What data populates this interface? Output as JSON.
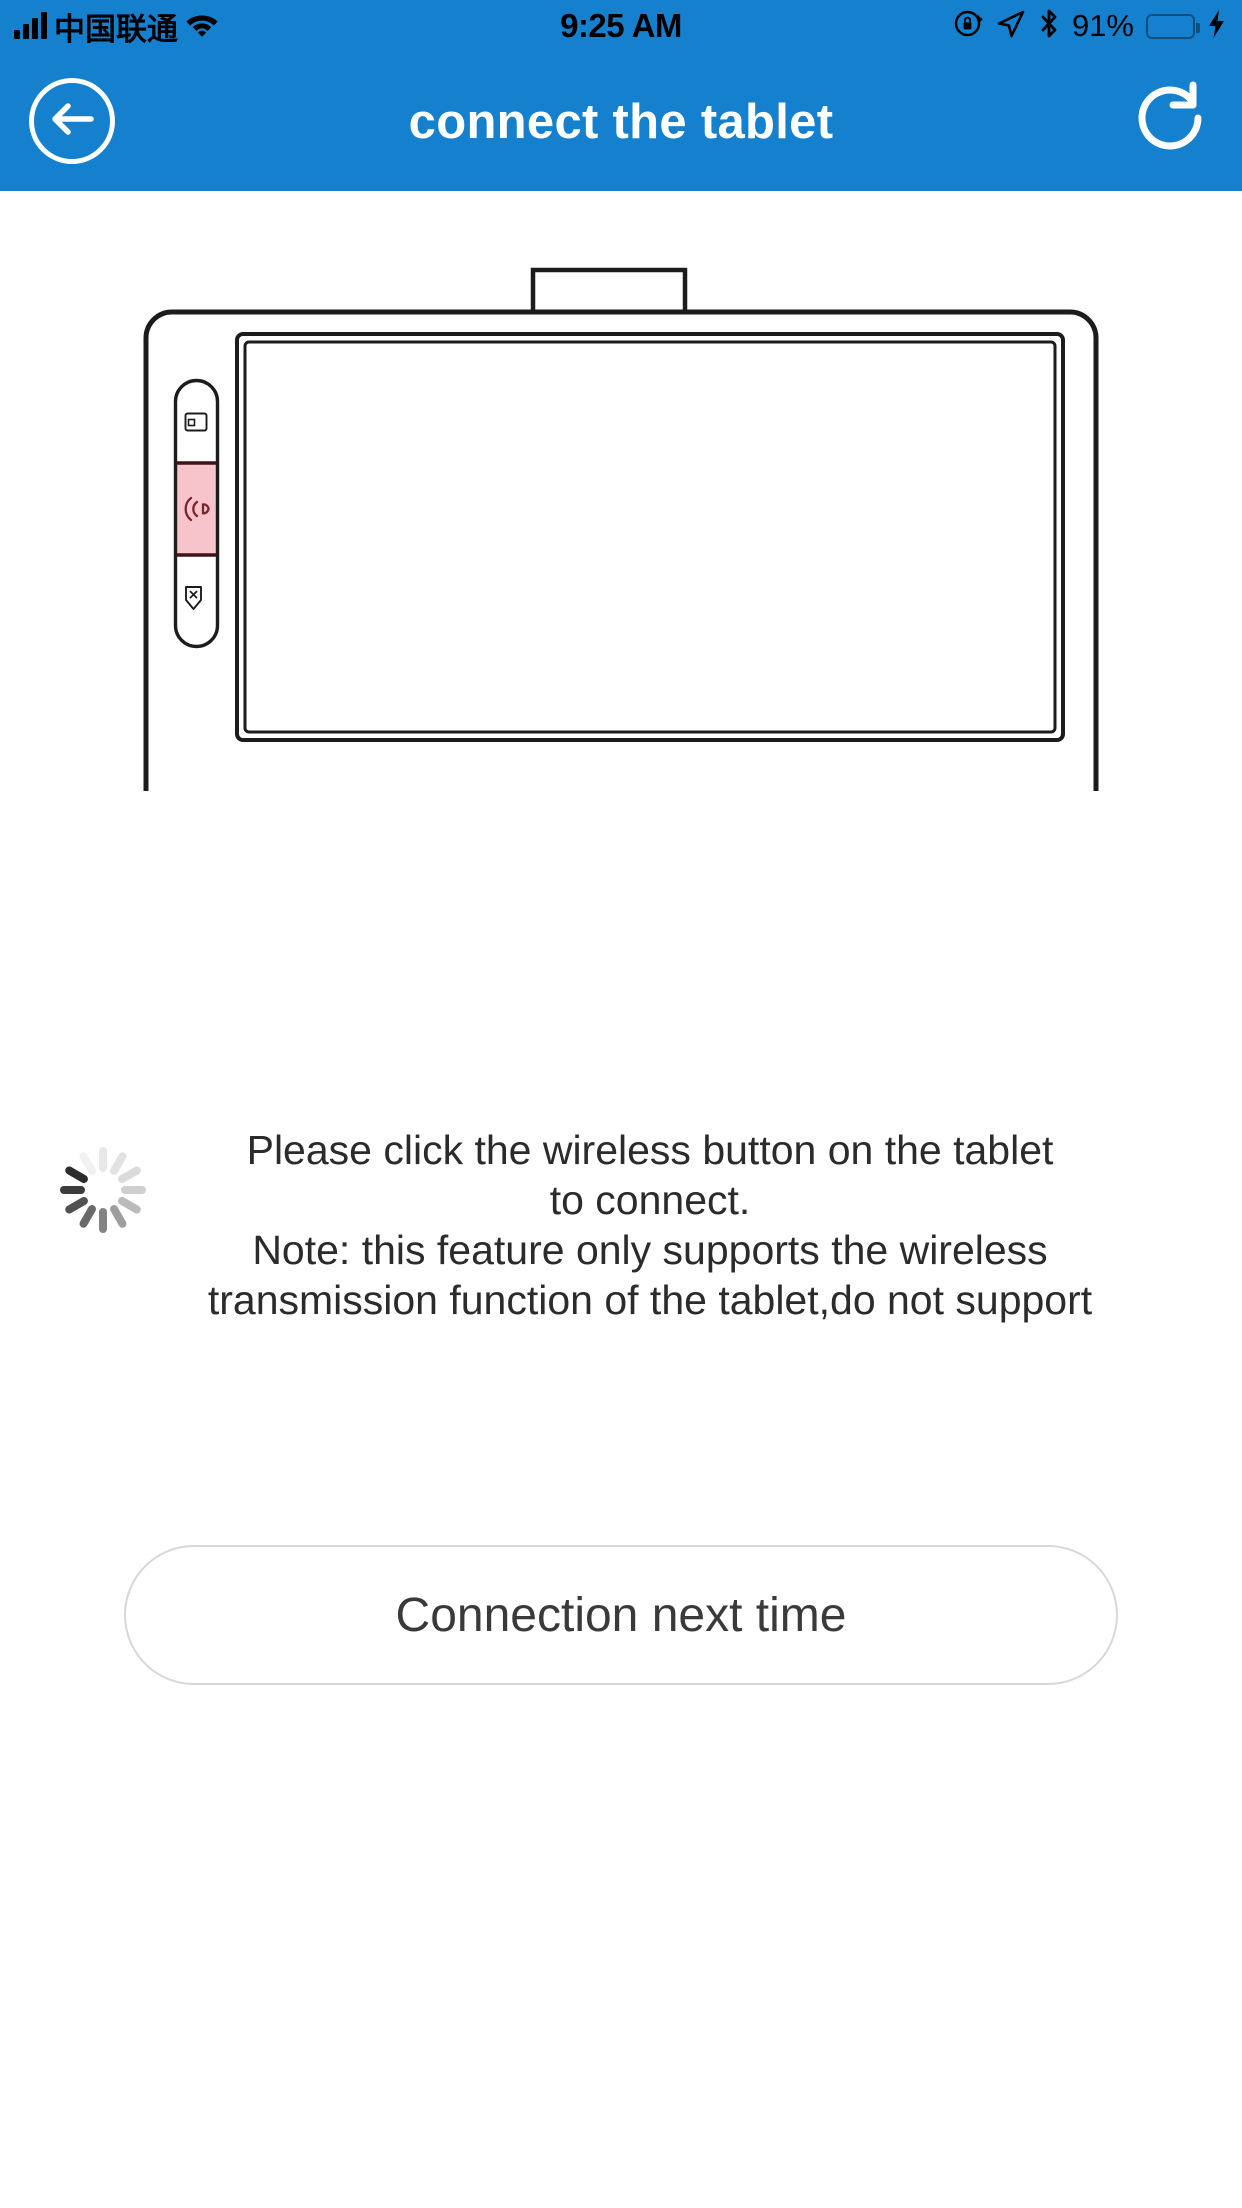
{
  "statusbar": {
    "carrier": "中国联通",
    "time": "9:25 AM",
    "battery_percent": "91%",
    "icons": {
      "signal": "signal-bars-icon",
      "wifi": "wifi-icon",
      "rotation_lock": "rotation-lock-icon",
      "location": "location-arrow-icon",
      "bluetooth": "bluetooth-icon",
      "battery": "battery-icon",
      "charging": "lightning-bolt-icon"
    },
    "colors": {
      "background": "#1580ce",
      "battery_fill": "#4cd95f",
      "battery_outline": "#0d4f80"
    }
  },
  "navbar": {
    "title": "connect the tablet",
    "back_icon": "back-arrow-icon",
    "refresh_icon": "refresh-icon",
    "colors": {
      "background": "#1580ce",
      "foreground": "#ffffff"
    }
  },
  "illustration": {
    "name": "graphics-tablet-illustration",
    "side_buttons": [
      {
        "name": "display-button",
        "icon": "card-display-icon",
        "active": false
      },
      {
        "name": "wireless-button",
        "icon": "wireless-signal-icon",
        "active": true
      },
      {
        "name": "shield-button",
        "icon": "shield-x-icon",
        "active": false
      }
    ],
    "colors": {
      "outline": "#1c1c1c",
      "active_fill": "#f8c4cc",
      "active_stroke": "#7a2430"
    }
  },
  "description": {
    "spinner_icon": "loading-spinner-icon",
    "lines": [
      "Please click the wireless button on the tablet",
      "to connect.",
      "Note: this feature only supports the wireless",
      "transmission function of the tablet,do not support"
    ]
  },
  "actions": {
    "next_time_label": "Connection next time"
  }
}
